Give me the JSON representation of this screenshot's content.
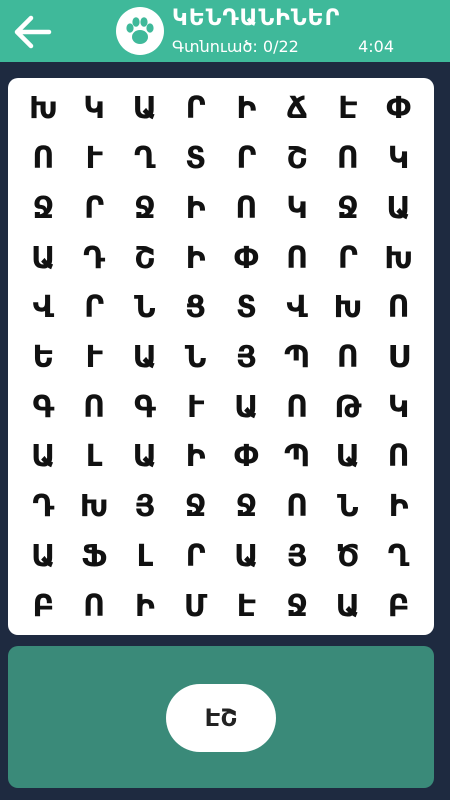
{
  "header": {
    "title": "ԿԵՆԴԱՆԻՆԵՐ",
    "found_label": "Գտնուած: 0/22",
    "timer": "4:04",
    "back_icon": "arrow-left-icon",
    "category_icon": "paw-icon"
  },
  "colors": {
    "header_bg": "#3fb99a",
    "page_bg": "#1e2a40",
    "panel_bg": "#3a8a79",
    "board_bg": "#ffffff"
  },
  "grid": {
    "rows": [
      [
        "Խ",
        "Կ",
        "Ա",
        "Ր",
        "Ի",
        "Ճ",
        "Է",
        "Փ"
      ],
      [
        "Ո",
        "Ւ",
        "Ղ",
        "Տ",
        "Ր",
        "Շ",
        "Ո",
        "Կ"
      ],
      [
        "Ջ",
        "Ր",
        "Ջ",
        "Ի",
        "Ո",
        "Կ",
        "Ջ",
        "Ա"
      ],
      [
        "Ա",
        "Դ",
        "Շ",
        "Ի",
        "Փ",
        "Ո",
        "Ր",
        "Խ"
      ],
      [
        "Վ",
        "Ր",
        "Ն",
        "Ց",
        "Տ",
        "Վ",
        "Խ",
        "Ո"
      ],
      [
        "Ե",
        "Ւ",
        "Ա",
        "Ն",
        "Յ",
        "Պ",
        "Ո",
        "Ս"
      ],
      [
        "Գ",
        "Ո",
        "Գ",
        "Ւ",
        "Ա",
        "Ո",
        "Թ",
        "Կ"
      ],
      [
        "Ա",
        "Լ",
        "Ա",
        "Ի",
        "Փ",
        "Պ",
        "Ա",
        "Ո"
      ],
      [
        "Դ",
        "Խ",
        "Յ",
        "Ջ",
        "Ջ",
        "Ո",
        "Ն",
        "Ի"
      ],
      [
        "Ա",
        "Ֆ",
        "Լ",
        "Ր",
        "Ա",
        "Յ",
        "Ծ",
        "Ղ"
      ],
      [
        "Բ",
        "Ո",
        "Ի",
        "Մ",
        "Է",
        "Ջ",
        "Ա",
        "Բ"
      ]
    ]
  },
  "bottom": {
    "current_word": "ԷՇ"
  }
}
